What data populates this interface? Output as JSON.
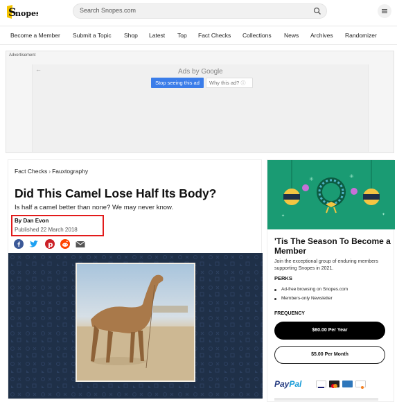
{
  "header": {
    "logo_text": "Snopes",
    "search": {
      "placeholder": "Search Snopes.com"
    },
    "menu_icon": "hamburger-icon"
  },
  "nav": {
    "items": [
      "Become a Member",
      "Submit a Topic",
      "Shop",
      "Latest",
      "Top",
      "Fact Checks",
      "Collections",
      "News",
      "Archives",
      "Randomizer"
    ]
  },
  "ad": {
    "label": "Advertisement",
    "ads_by": "Ads by",
    "google": "Google",
    "stop_button": "Stop seeing this ad",
    "why_button": "Why this ad?"
  },
  "article": {
    "breadcrumb": [
      "Fact Checks",
      "Fauxtography"
    ],
    "title": "Did This Camel Lose Half Its Body?",
    "subtitle": "Is half a camel better than none? We may never know.",
    "byline": "By Dan Evon",
    "published": "Published 22 March 2018",
    "share_icons": [
      "facebook-icon",
      "twitter-icon",
      "pinterest-icon",
      "reddit-icon",
      "email-icon"
    ]
  },
  "sidebar": {
    "promo_title": "'Tis The Season To Become a Member",
    "promo_text": "Join the exceptional group of enduring members supporting Snopes in 2021.",
    "perks_heading": "PERKS",
    "perks": [
      "Ad-free browsing on Snopes.com",
      "Members-only Newsletter"
    ],
    "frequency_heading": "FREQUENCY",
    "year_button": "$60.00 Per Year",
    "month_button": "$5.00 Per Month",
    "paypal": {
      "pay": "Pay",
      "pal": "Pal"
    },
    "card_icons": [
      "visa-icon",
      "mastercard-icon",
      "amex-icon",
      "discover-icon"
    ]
  },
  "colors": {
    "accent_green": "#1a9b73",
    "highlight_red": "#e21b1b",
    "google_blue": "#3b7de9",
    "hero_navy": "#1f3048"
  }
}
